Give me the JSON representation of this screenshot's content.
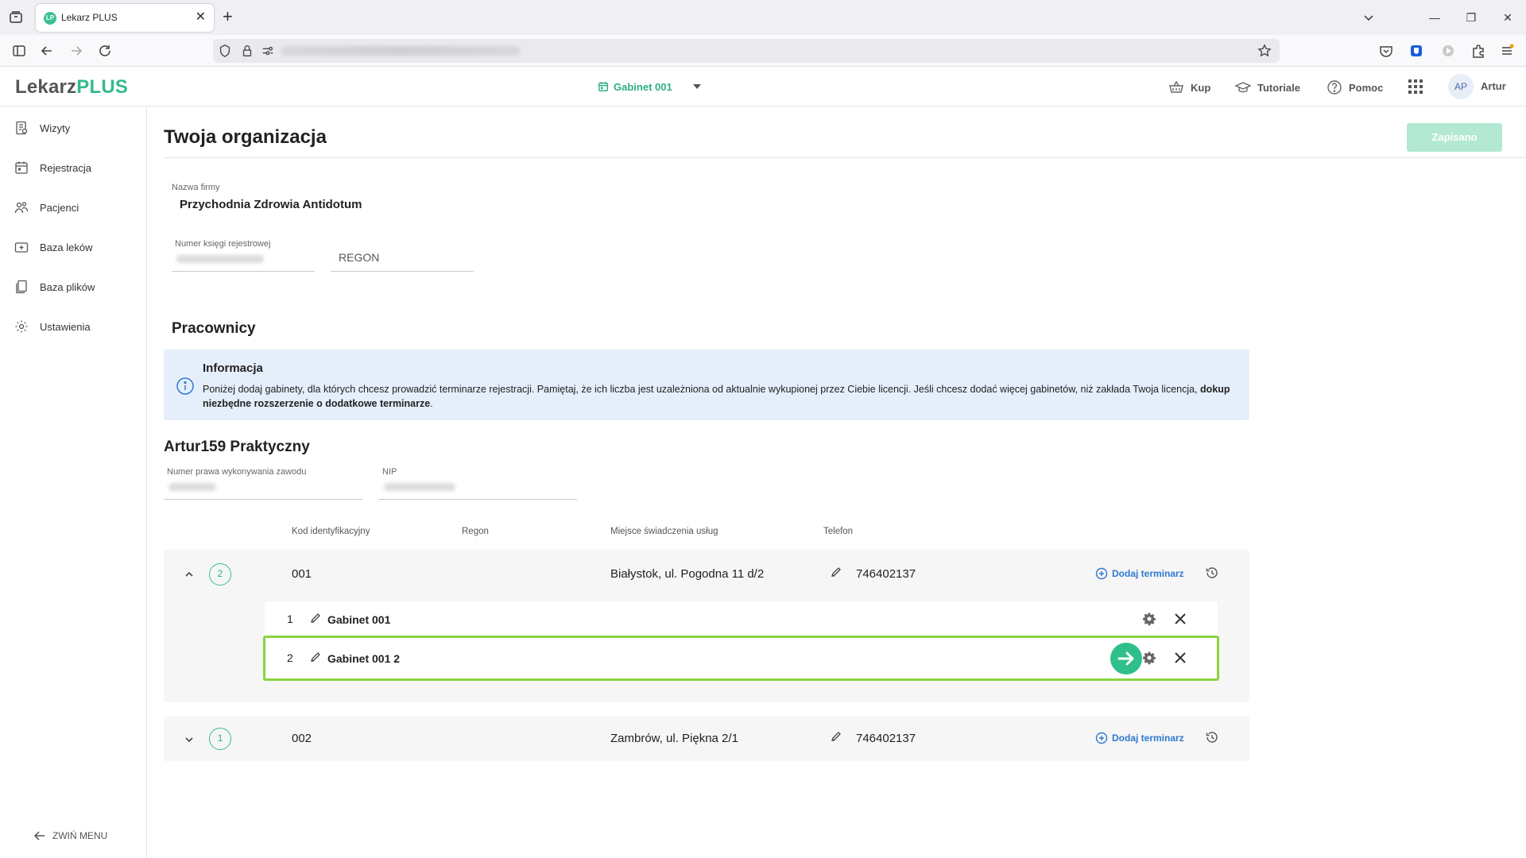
{
  "browser": {
    "tab_title": "Lekarz PLUS",
    "tab_favicon_text": "LP",
    "url_hidden": true
  },
  "header": {
    "logo_part1": "Lekarz",
    "logo_part2": "PLUS",
    "gabinet_selector": "Gabinet 001",
    "buy": "Kup",
    "tutorials": "Tutoriale",
    "help": "Pomoc",
    "avatar_initials": "AP",
    "user_name": "Artur"
  },
  "sidebar": {
    "items": [
      {
        "label": "Wizyty",
        "icon": "document-list-icon"
      },
      {
        "label": "Rejestracja",
        "icon": "calendar-icon"
      },
      {
        "label": "Pacjenci",
        "icon": "people-icon"
      },
      {
        "label": "Baza leków",
        "icon": "medical-kit-icon"
      },
      {
        "label": "Baza plików",
        "icon": "files-icon"
      },
      {
        "label": "Ustawienia",
        "icon": "gear-icon"
      }
    ],
    "collapse_label": "ZWIŃ MENU"
  },
  "main": {
    "title": "Twoja organizacja",
    "save_button": "Zapisano",
    "company": {
      "name_label": "Nazwa firmy",
      "name_value": "Przychodnia Zdrowia Antidotum",
      "register_label": "Numer księgi rejestrowej",
      "regon_placeholder": "REGON"
    },
    "employees_title": "Pracownicy",
    "info": {
      "title": "Informacja",
      "text": "Poniżej dodaj gabinety, dla których chcesz prowadzić terminarze rejestracji. Pamiętaj, że ich liczba jest uzależniona od aktualnie wykupionej przez Ciebie licencji. Jeśli chcesz dodać więcej gabinetów, niż zakłada Twoja licencja,",
      "link_text": "dokup niezbędne rozszerzenie o dodatkowe terminarze",
      "text_end": "."
    },
    "employee": {
      "name": "Artur159 Praktyczny",
      "license_label": "Numer prawa wykonywania zawodu",
      "nip_label": "NIP"
    },
    "table": {
      "headers": [
        "Kod identyfikacyjny",
        "Regon",
        "Miejsce świadczenia usług",
        "Telefon"
      ],
      "rows": [
        {
          "count": "2",
          "code": "001",
          "place": "Białystok, ul. Pogodna 11 d/2",
          "phone": "746402137",
          "add_label": "Dodaj terminarz",
          "expanded": true,
          "gabinets": [
            {
              "num": "1",
              "name": "Gabinet 001"
            },
            {
              "num": "2",
              "name": "Gabinet 001 2"
            }
          ]
        },
        {
          "count": "1",
          "code": "002",
          "place": "Zambrów, ul. Piękna 2/1",
          "phone": "746402137",
          "add_label": "Dodaj terminarz",
          "expanded": false
        }
      ]
    }
  },
  "colors": {
    "brand_green": "#35b98b",
    "highlight_border": "#8bd33f",
    "info_bg": "#e5effb",
    "link_blue": "#2f79d0"
  }
}
